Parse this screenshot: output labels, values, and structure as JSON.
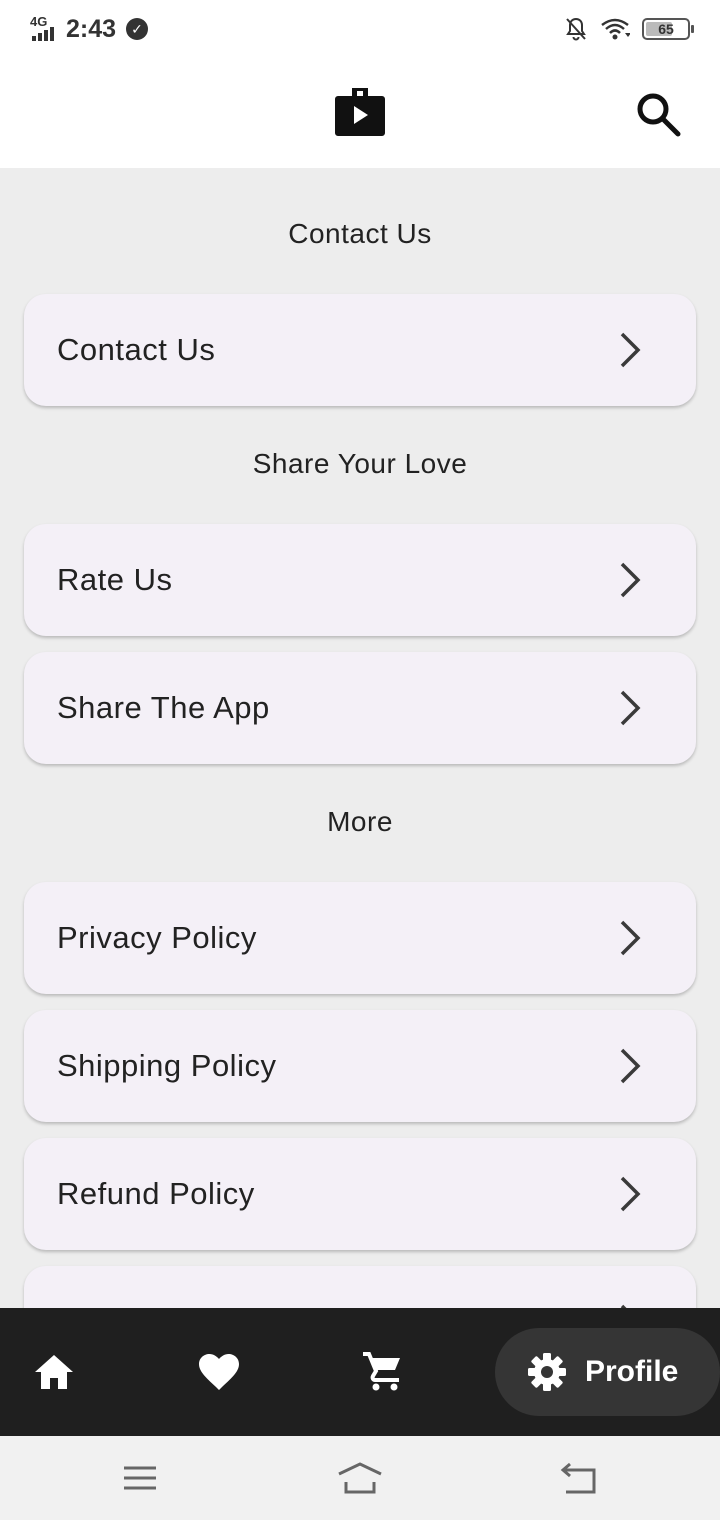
{
  "status_bar": {
    "network": "4G",
    "time": "2:43",
    "battery": "65",
    "battery_level": 0.65
  },
  "app_bar": {
    "logo_icon": "shopping-bag-play-icon",
    "search_icon": "search-icon"
  },
  "sections": [
    {
      "title": "Contact Us",
      "items": [
        {
          "label": "Contact Us"
        }
      ]
    },
    {
      "title": "Share Your Love",
      "items": [
        {
          "label": "Rate Us"
        },
        {
          "label": "Share The App"
        }
      ]
    },
    {
      "title": "More",
      "items": [
        {
          "label": "Privacy Policy"
        },
        {
          "label": "Shipping Policy"
        },
        {
          "label": "Refund Policy"
        }
      ]
    }
  ],
  "bottom_nav": {
    "items": [
      {
        "icon": "home-icon"
      },
      {
        "icon": "heart-icon"
      },
      {
        "icon": "cart-icon"
      },
      {
        "icon": "gear-icon",
        "label": "Profile",
        "active": true
      }
    ]
  },
  "colors": {
    "background": "#ededed",
    "card": "#f4f0f7",
    "nav_bar": "#1f1f1f",
    "nav_active": "#353535"
  }
}
